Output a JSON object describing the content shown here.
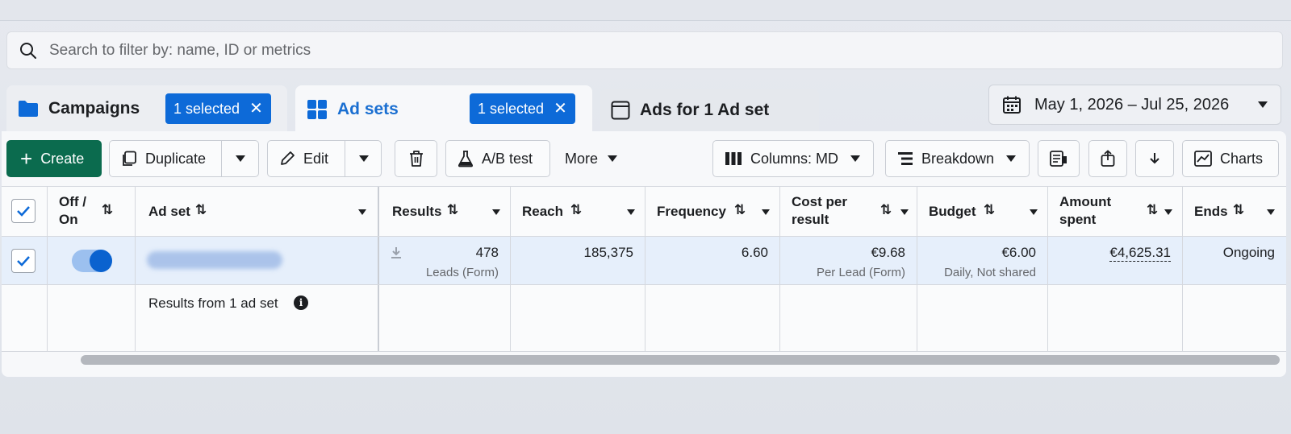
{
  "search": {
    "placeholder": "Search to filter by: name, ID or metrics"
  },
  "tabs": {
    "campaigns": {
      "label": "Campaigns",
      "badge": "1 selected"
    },
    "adsets": {
      "label": "Ad sets",
      "badge": "1 selected"
    },
    "ads": {
      "label": "Ads for 1 Ad set"
    }
  },
  "date_range": "May 1, 2026 – Jul 25, 2026",
  "toolbar": {
    "create": "Create",
    "duplicate": "Duplicate",
    "edit": "Edit",
    "ab_test": "A/B test",
    "more": "More",
    "columns": "Columns: MD",
    "breakdown": "Breakdown",
    "charts": "Charts"
  },
  "columns": {
    "off_on_1": "Off /",
    "off_on_2": "On",
    "ad_set": "Ad set",
    "results": "Results",
    "reach": "Reach",
    "frequency": "Frequency",
    "cost_1": "Cost per",
    "cost_2": "result",
    "budget": "Budget",
    "amount_1": "Amount",
    "amount_2": "spent",
    "ends": "Ends"
  },
  "row": {
    "results": "478",
    "results_sub": "Leads (Form)",
    "reach": "185,375",
    "frequency": "6.60",
    "cost": "€9.68",
    "cost_sub": "Per Lead (Form)",
    "budget": "€6.00",
    "budget_sub": "Daily, Not shared",
    "amount": "€4,625.31",
    "ends": "Ongoing",
    "toggle_on": true,
    "selected": true
  },
  "summary": {
    "label": "Results from 1 ad set"
  },
  "colors": {
    "accent": "#0d6ad8",
    "create": "#0b6b4e",
    "selected_row": "#e6effb"
  }
}
